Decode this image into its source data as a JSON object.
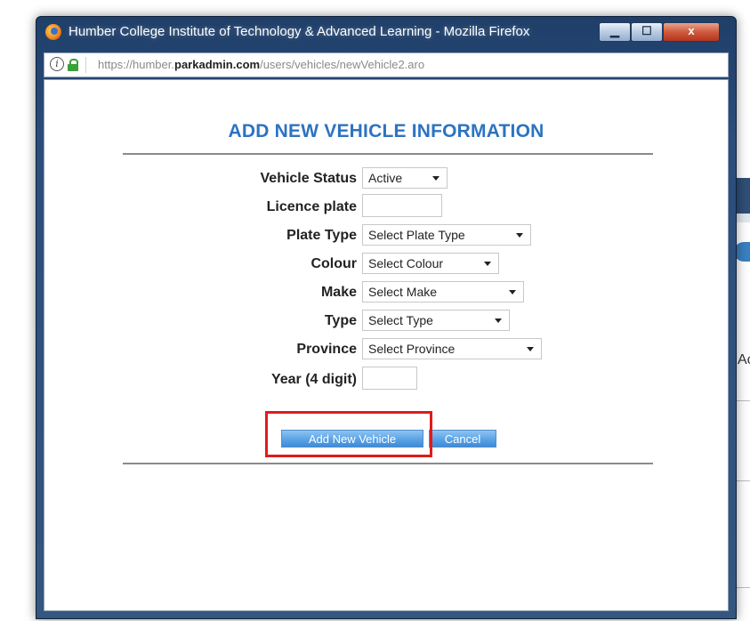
{
  "window": {
    "title": "Humber College Institute of Technology & Advanced Learning - Mozilla Firefox",
    "minimize_glyph": "▁",
    "maximize_glyph": "☐",
    "close_glyph": "x"
  },
  "urlbar": {
    "prefix": "https://humber.",
    "domain": "parkadmin.com",
    "path": "/users/vehicles/newVehicle2.aro",
    "info_glyph": "i"
  },
  "form": {
    "title": "ADD NEW VEHICLE INFORMATION",
    "fields": {
      "vehicle_status": {
        "label": "Vehicle Status",
        "value": "Active"
      },
      "licence_plate": {
        "label": "Licence plate",
        "value": ""
      },
      "plate_type": {
        "label": "Plate Type",
        "value": "Select Plate Type"
      },
      "colour": {
        "label": "Colour",
        "value": "Select Colour"
      },
      "make": {
        "label": "Make",
        "value": "Select Make"
      },
      "type": {
        "label": "Type",
        "value": "Select Type"
      },
      "province": {
        "label": "Province",
        "value": "Select Province"
      },
      "year": {
        "label": "Year (4 digit)",
        "value": ""
      }
    },
    "buttons": {
      "add": "Add New Vehicle",
      "cancel": "Cancel"
    }
  },
  "background": {
    "partial_text": "Ac"
  },
  "colors": {
    "title_blue": "#2d73c0",
    "button_blue": "#5aa3e6",
    "highlight_red": "#e01b1b",
    "titlebar_navy": "#2b4d7b"
  },
  "icons": [
    "firefox-icon",
    "info-icon",
    "lock-icon",
    "minimize-icon",
    "maximize-icon",
    "close-icon",
    "dropdown-arrow-icon"
  ]
}
